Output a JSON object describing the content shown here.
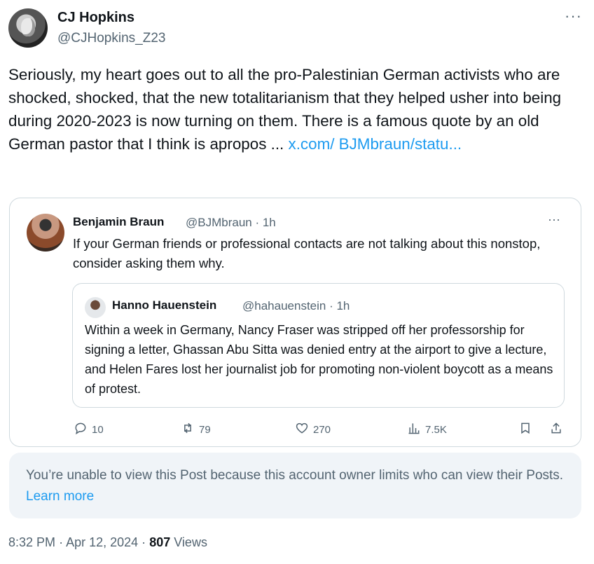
{
  "post": {
    "author_name": "CJ Hopkins",
    "author_handle": "@CJHopkins_Z23",
    "more_label": "···",
    "text": "Seriously, my heart goes out to all the pro-Palestinian German activists who are shocked, shocked, that the new totalitarianism that they helped usher into being during 2020-2023 is now turning on them. There is a famous quote by an old German pastor that I think is apropos ...",
    "link_text": "x.com/ BJMbraun/statu...",
    "time": "8:32 PM",
    "date": "Apr 12, 2024",
    "views_count": "807",
    "views_label": "Views",
    "separator": "·"
  },
  "quote": {
    "name": "Benjamin Braun",
    "meta": "@BJMbraun · 1h",
    "more_label": "···",
    "text": "If your German friends or professional contacts are not talking about this nonstop, consider asking them why.",
    "nested": {
      "name": "Hanno Hauenstein",
      "meta": "@hahauenstein · 1h",
      "text": "Within a week in Germany, Nancy Fraser was stripped off her professorship for signing a letter, Ghassan Abu Sitta was denied entry at the airport to give a lecture, and Helen Fares lost her journalist job for promoting non-violent boycott as a means of protest."
    },
    "actions": {
      "replies": "10",
      "reposts": "79",
      "likes": "270",
      "views": "7.5K"
    }
  },
  "notice": {
    "text": "You’re unable to view this Post because this account owner limits who can view their Posts.",
    "link": "Learn more"
  },
  "colors": {
    "accent": "#1d9bf0",
    "text": "#0f1419",
    "muted": "#536471",
    "border": "#cfd9de",
    "notice_bg": "#f0f4f8"
  },
  "icons": [
    "reply-icon",
    "repost-icon",
    "like-icon",
    "views-icon",
    "bookmark-icon",
    "share-icon",
    "more-icon"
  ]
}
